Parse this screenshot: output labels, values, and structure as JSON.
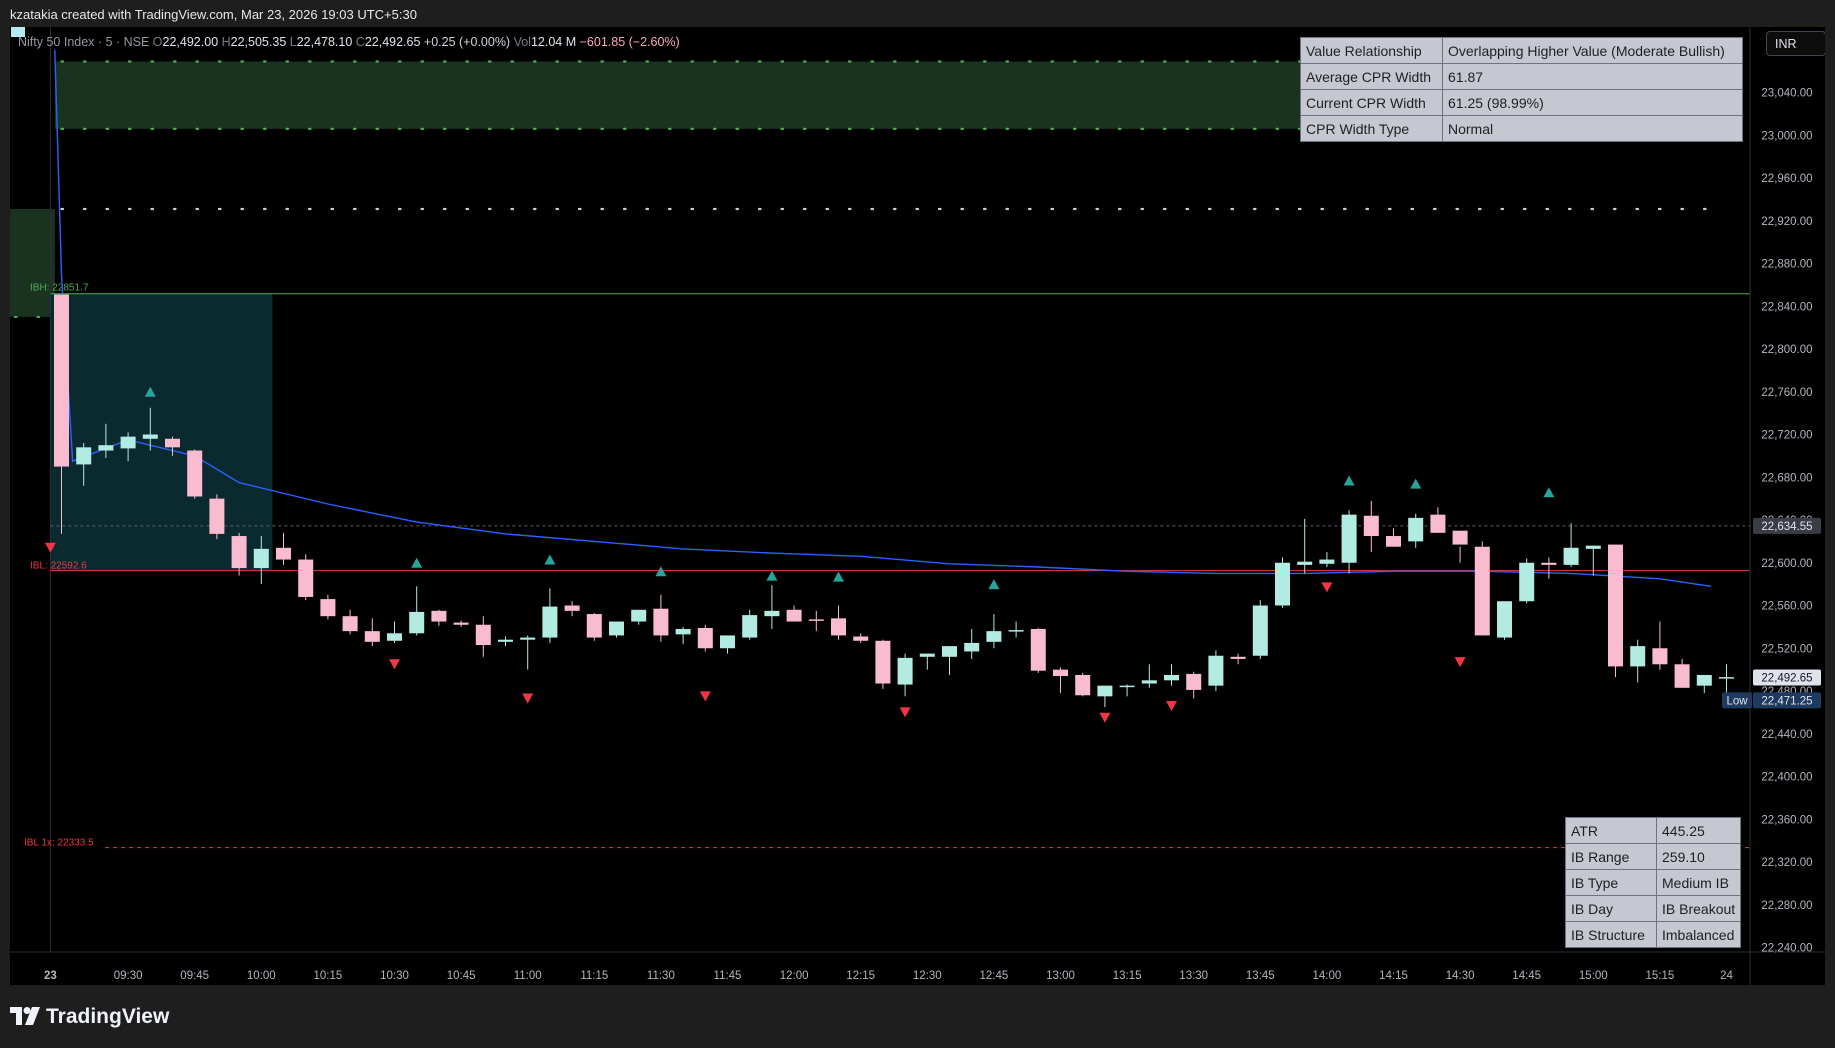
{
  "header": {
    "attribution": "kzatakia created with TradingView.com, Mar 23, 2026 19:03 UTC+5:30"
  },
  "legend": {
    "symbol": "Nifty 50 Index · 5 · NSE",
    "o_label": "O",
    "o_value": "22,492.00",
    "h_label": "H",
    "h_value": "22,505.35",
    "l_label": "L",
    "l_value": "22,478.10",
    "c_label": "C",
    "c_value": "22,492.65",
    "change": "+0.25 (+0.00%)",
    "vol_label": "Vol",
    "vol_value": "12.04 M",
    "vol_change": "−601.85 (−2.60%)"
  },
  "currency": "INR",
  "cpr_table": [
    {
      "label": "Value Relationship",
      "value": "Overlapping Higher Value (Moderate Bullish)"
    },
    {
      "label": "Average CPR Width",
      "value": "61.87"
    },
    {
      "label": "Current CPR Width",
      "value": "61.25 (98.99%)"
    },
    {
      "label": "CPR Width Type",
      "value": "Normal"
    }
  ],
  "ib_table": [
    {
      "label": "ATR",
      "value": "445.25"
    },
    {
      "label": "IB Range",
      "value": "259.10"
    },
    {
      "label": "IB Type",
      "value": "Medium IB"
    },
    {
      "label": "IB Day",
      "value": "IB Breakout"
    },
    {
      "label": "IB Structure",
      "value": "Imbalanced"
    }
  ],
  "footer": {
    "brand": "TradingView"
  },
  "colors": {
    "up": "#b2ebe2",
    "down": "#f8bbd0",
    "vwap": "#2962ff",
    "ibh": "#4caf50",
    "ibl": "#f23645",
    "cpr_zone": "#1a3320",
    "ib_zone": "#0a2a30",
    "buy_signal": "#26a69a",
    "sell_signal": "#f23645",
    "dots": "#c8d4c8",
    "green_dots": "#4caf50"
  },
  "chart_data": {
    "type": "candlestick",
    "ylim": [
      22220,
      23080
    ],
    "yticks": [
      23040,
      23000,
      22960,
      22920,
      22880,
      22840,
      22800,
      22760,
      22720,
      22680,
      22640,
      22600,
      22560,
      22520,
      22480,
      22440,
      22400,
      22360,
      22320,
      22280,
      22240
    ],
    "ytick_labels": [
      "23,040.00",
      "23,000.00",
      "22,960.00",
      "22,920.00",
      "22,880.00",
      "22,840.00",
      "22,800.00",
      "22,760.00",
      "22,720.00",
      "22,680.00",
      "22,640.00",
      "22,600.00",
      "22,560.00",
      "22,520.00",
      "22,480.00",
      "22,440.00",
      "22,400.00",
      "22,360.00",
      "22,320.00",
      "22,280.00",
      "22,240.00"
    ],
    "xticks": [
      {
        "bar": -0.5,
        "label": "23",
        "bold": true
      },
      {
        "bar": 3,
        "label": "09:30"
      },
      {
        "bar": 6,
        "label": "09:45"
      },
      {
        "bar": 9,
        "label": "10:00"
      },
      {
        "bar": 12,
        "label": "10:15"
      },
      {
        "bar": 15,
        "label": "10:30"
      },
      {
        "bar": 18,
        "label": "10:45"
      },
      {
        "bar": 21,
        "label": "11:00"
      },
      {
        "bar": 24,
        "label": "11:15"
      },
      {
        "bar": 27,
        "label": "11:30"
      },
      {
        "bar": 30,
        "label": "11:45"
      },
      {
        "bar": 33,
        "label": "12:00"
      },
      {
        "bar": 36,
        "label": "12:15"
      },
      {
        "bar": 39,
        "label": "12:30"
      },
      {
        "bar": 42,
        "label": "12:45"
      },
      {
        "bar": 45,
        "label": "13:00"
      },
      {
        "bar": 48,
        "label": "13:15"
      },
      {
        "bar": 51,
        "label": "13:30"
      },
      {
        "bar": 54,
        "label": "13:45"
      },
      {
        "bar": 57,
        "label": "14:00"
      },
      {
        "bar": 60,
        "label": "14:15"
      },
      {
        "bar": 63,
        "label": "14:30"
      },
      {
        "bar": 66,
        "label": "14:45"
      },
      {
        "bar": 69,
        "label": "15:00"
      },
      {
        "bar": 72,
        "label": "15:15"
      },
      {
        "bar": 75,
        "label": "24"
      }
    ],
    "candles": [
      [
        22851,
        22851,
        22627,
        22690
      ],
      [
        22692,
        22712,
        22672,
        22708
      ],
      [
        22705,
        22730,
        22698,
        22710
      ],
      [
        22707,
        22722,
        22695,
        22718
      ],
      [
        22716,
        22745,
        22705,
        22720
      ],
      [
        22716,
        22718,
        22700,
        22708
      ],
      [
        22705,
        22706,
        22660,
        22662
      ],
      [
        22660,
        22664,
        22622,
        22627
      ],
      [
        22625,
        22628,
        22588,
        22595
      ],
      [
        22595,
        22625,
        22580,
        22613
      ],
      [
        22614,
        22628,
        22598,
        22603
      ],
      [
        22603,
        22608,
        22565,
        22568
      ],
      [
        22566,
        22570,
        22547,
        22550
      ],
      [
        22550,
        22556,
        22533,
        22536
      ],
      [
        22536,
        22548,
        22522,
        22526
      ],
      [
        22527,
        22545,
        22525,
        22534
      ],
      [
        22534,
        22578,
        22532,
        22554
      ],
      [
        22555,
        22556,
        22541,
        22545
      ],
      [
        22544,
        22546,
        22540,
        22542
      ],
      [
        22542,
        22550,
        22512,
        22523
      ],
      [
        22526,
        22531,
        22522,
        22528
      ],
      [
        22528,
        22532,
        22500,
        22530
      ],
      [
        22530,
        22576,
        22525,
        22559
      ],
      [
        22560,
        22564,
        22550,
        22555
      ],
      [
        22552,
        22553,
        22527,
        22530
      ],
      [
        22532,
        22545,
        22530,
        22545
      ],
      [
        22545,
        22556,
        22542,
        22556
      ],
      [
        22557,
        22570,
        22526,
        22532
      ],
      [
        22533,
        22540,
        22524,
        22538
      ],
      [
        22539,
        22542,
        22517,
        22520
      ],
      [
        22520,
        22531,
        22515,
        22532
      ],
      [
        22530,
        22556,
        22528,
        22551
      ],
      [
        22550,
        22579,
        22538,
        22555
      ],
      [
        22556,
        22560,
        22548,
        22545
      ],
      [
        22547,
        22555,
        22536,
        22546
      ],
      [
        22548,
        22560,
        22528,
        22532
      ],
      [
        22531,
        22534,
        22525,
        22527
      ],
      [
        22527,
        22528,
        22482,
        22487
      ],
      [
        22486,
        22515,
        22475,
        22511
      ],
      [
        22512,
        22514,
        22500,
        22515
      ],
      [
        22512,
        22522,
        22495,
        22522
      ],
      [
        22517,
        22538,
        22510,
        22525
      ],
      [
        22526,
        22552,
        22520,
        22536
      ],
      [
        22537,
        22545,
        22530,
        22537
      ],
      [
        22538,
        22539,
        22497,
        22499
      ],
      [
        22500,
        22502,
        22478,
        22494
      ],
      [
        22495,
        22497,
        22475,
        22476
      ],
      [
        22475,
        22485,
        22465,
        22485
      ],
      [
        22485,
        22486,
        22475,
        22485
      ],
      [
        22487,
        22505,
        22483,
        22490
      ],
      [
        22490,
        22505,
        22485,
        22495
      ],
      [
        22496,
        22498,
        22473,
        22481
      ],
      [
        22485,
        22518,
        22480,
        22513
      ],
      [
        22512,
        22515,
        22505,
        22510
      ],
      [
        22513,
        22565,
        22510,
        22560
      ],
      [
        22560,
        22605,
        22558,
        22600
      ],
      [
        22598,
        22641,
        22590,
        22601
      ],
      [
        22599,
        22610,
        22596,
        22603
      ],
      [
        22600,
        22649,
        22590,
        22645
      ],
      [
        22644,
        22658,
        22610,
        22625
      ],
      [
        22625,
        22632,
        22615,
        22615
      ],
      [
        22620,
        22646,
        22614,
        22642
      ],
      [
        22645,
        22652,
        22628,
        22628
      ],
      [
        22630,
        22615,
        22600,
        22617
      ],
      [
        22615,
        22620,
        22600,
        22532
      ],
      [
        22530,
        22540,
        22528,
        22564
      ],
      [
        22564,
        22604,
        22562,
        22600
      ],
      [
        22600,
        22605,
        22585,
        22598
      ],
      [
        22598,
        22637,
        22596,
        22614
      ],
      [
        22613,
        22616,
        22588,
        22616
      ],
      [
        22617,
        22617,
        22493,
        22503
      ],
      [
        22503,
        22528,
        22488,
        22522
      ],
      [
        22520,
        22545,
        22500,
        22505
      ],
      [
        22505,
        22510,
        22483,
        22483
      ],
      [
        22485,
        22495,
        22478,
        22495
      ],
      [
        22492,
        22505,
        22478,
        22493
      ]
    ],
    "vwap": [
      [
        -0.3,
        23080
      ],
      [
        0.0,
        22870
      ],
      [
        0.5,
        22695
      ],
      [
        3,
        22715
      ],
      [
        6,
        22700
      ],
      [
        8,
        22675
      ],
      [
        12,
        22655
      ],
      [
        16,
        22638
      ],
      [
        20,
        22627
      ],
      [
        24,
        22620
      ],
      [
        28,
        22613
      ],
      [
        32,
        22609
      ],
      [
        36,
        22606
      ],
      [
        40,
        22599
      ],
      [
        44,
        22596
      ],
      [
        48,
        22592
      ],
      [
        52,
        22590
      ],
      [
        56,
        22590
      ],
      [
        60,
        22592
      ],
      [
        64,
        22592
      ],
      [
        68,
        22590
      ],
      [
        72,
        22585
      ],
      [
        74.3,
        22578
      ]
    ],
    "buy_signals": [
      [
        4,
        22760
      ],
      [
        16,
        22600
      ],
      [
        22,
        22603
      ],
      [
        27,
        22592
      ],
      [
        32,
        22588
      ],
      [
        35,
        22587
      ],
      [
        42,
        22580
      ],
      [
        58,
        22677
      ],
      [
        61,
        22674
      ],
      [
        67,
        22666
      ]
    ],
    "sell_signals": [
      [
        -0.5,
        22614
      ],
      [
        15,
        22505
      ],
      [
        21,
        22473
      ],
      [
        29,
        22475
      ],
      [
        38,
        22460
      ],
      [
        47,
        22455
      ],
      [
        50,
        22466
      ],
      [
        57,
        22577
      ],
      [
        63,
        22507
      ]
    ],
    "ibh": {
      "value": 22851.7,
      "label": "IBH: 22851.7"
    },
    "ibl": {
      "value": 22592.6,
      "label": "IBL: 22592.6"
    },
    "ibl_ext": {
      "value": 22333.5,
      "label": "IBL 1x: 22333.5"
    },
    "cpr_zone": [
      23069,
      23006
    ],
    "cpr_left_zone": [
      22931,
      22830
    ],
    "dot_line": 22931,
    "ib_zone": {
      "from_bar": -0.5,
      "to_bar": 9.5,
      "top": 22851.7,
      "bottom": 22592.6
    },
    "dashed_last_level": 22634.55,
    "price_labels": [
      {
        "value": 22634.55,
        "text": "22,634.55",
        "style": "grey"
      },
      {
        "value": 22492.65,
        "text": "22,492.65",
        "style": "last"
      },
      {
        "value": 22471.25,
        "text": "22,471.25",
        "style": "low",
        "tag": "Low"
      }
    ]
  }
}
